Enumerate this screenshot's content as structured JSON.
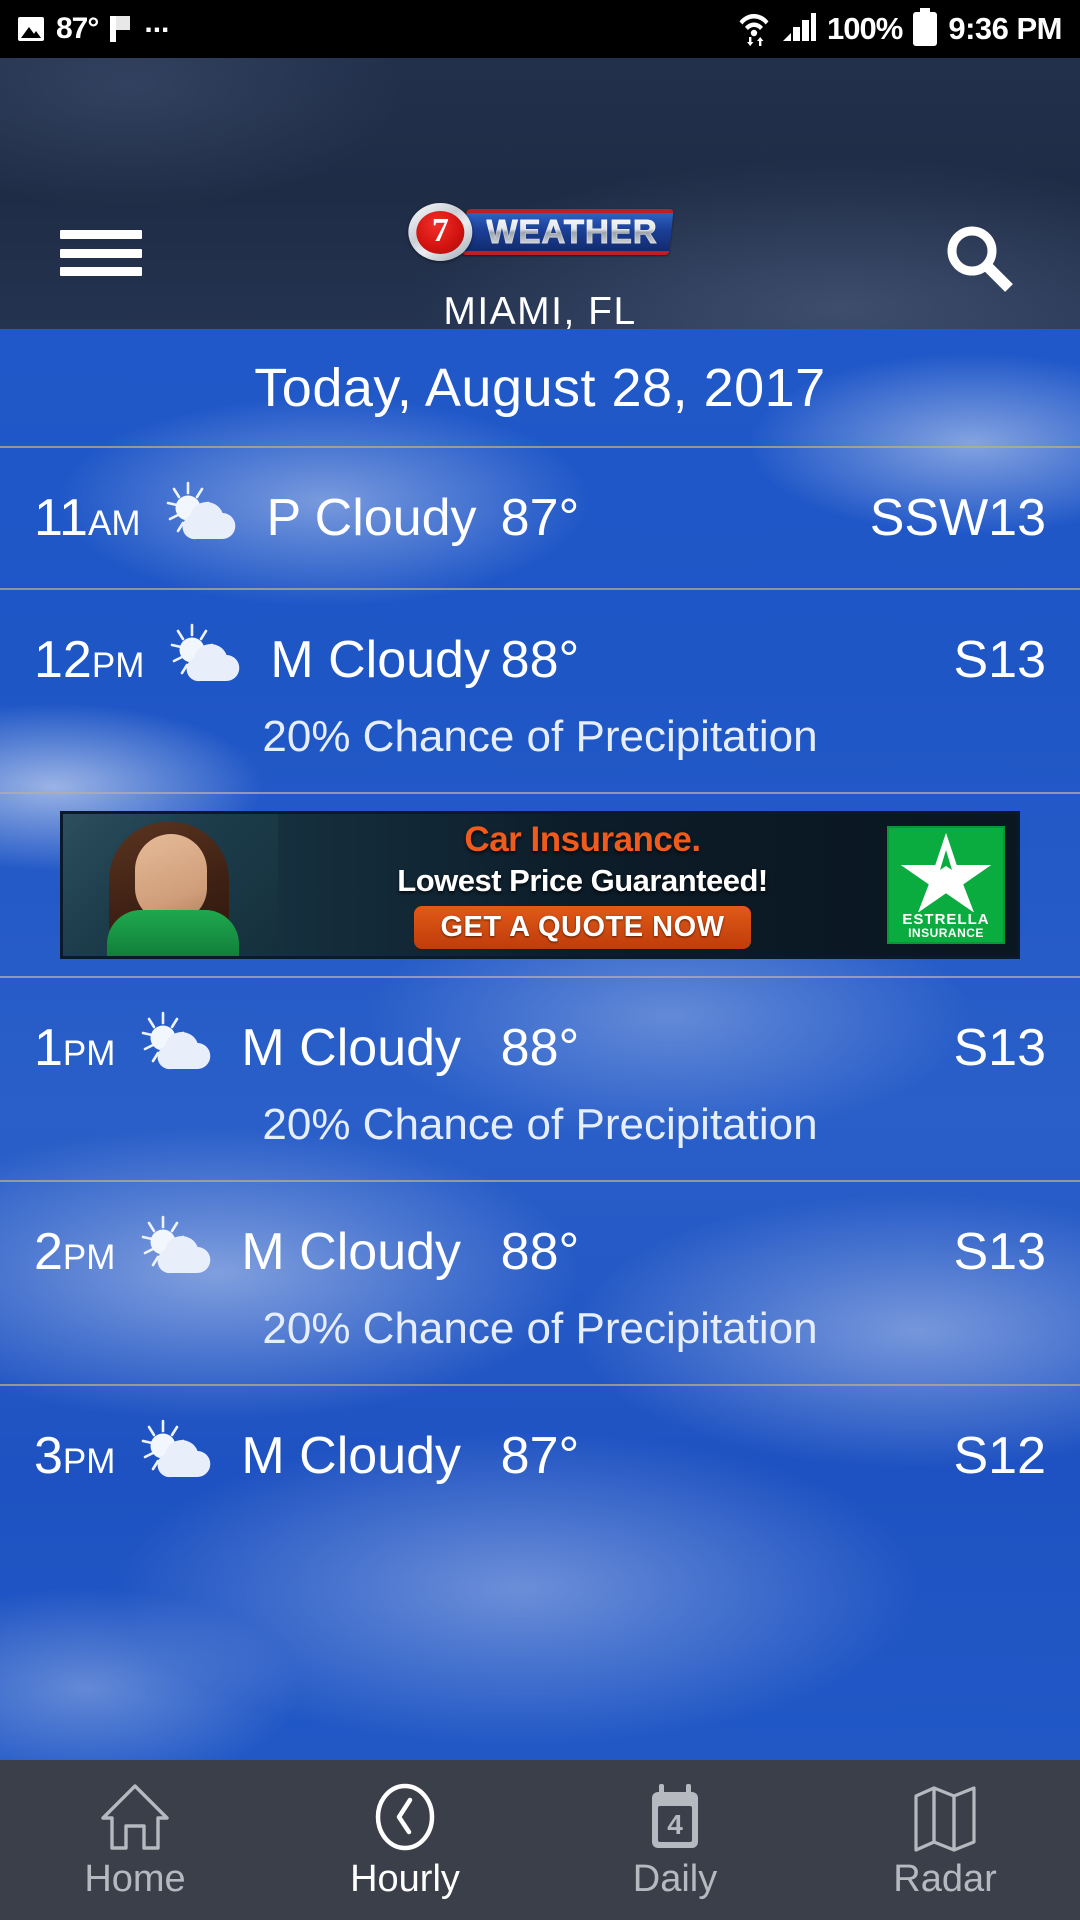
{
  "status_bar": {
    "temperature": "87°",
    "overflow_dots": "...",
    "battery_percent": "100%",
    "time": "9:36 PM",
    "icons": [
      "photo-icon",
      "flag-icon",
      "wifi-icon",
      "signal-icon",
      "battery-icon"
    ]
  },
  "header": {
    "menu_icon": "hamburger-menu-icon",
    "search_icon": "search-icon",
    "logo_number": "7",
    "logo_word": "WEATHER",
    "location": "MIAMI, FL"
  },
  "main": {
    "date_heading": "Today, August 28, 2017",
    "hours": [
      {
        "time": "11",
        "meridiem": "AM",
        "icon": "partly-cloudy-icon",
        "condition": "P Cloudy",
        "temperature": "87°",
        "wind": "SSW13",
        "precipitation": null
      },
      {
        "time": "12",
        "meridiem": "PM",
        "icon": "partly-cloudy-icon",
        "condition": "M Cloudy",
        "temperature": "88°",
        "wind": "S13",
        "precipitation": "20% Chance of Precipitation"
      },
      {
        "time": "1",
        "meridiem": "PM",
        "icon": "partly-cloudy-icon",
        "condition": "M Cloudy",
        "temperature": "88°",
        "wind": "S13",
        "precipitation": "20% Chance of Precipitation"
      },
      {
        "time": "2",
        "meridiem": "PM",
        "icon": "partly-cloudy-icon",
        "condition": "M Cloudy",
        "temperature": "88°",
        "wind": "S13",
        "precipitation": "20% Chance of Precipitation"
      },
      {
        "time": "3",
        "meridiem": "PM",
        "icon": "partly-cloudy-icon",
        "condition": "M Cloudy",
        "temperature": "87°",
        "wind": "S12",
        "precipitation": null
      }
    ]
  },
  "advertisement": {
    "headline": "Car Insurance.",
    "subhead": "Lowest Price Guaranteed!",
    "cta_label": "GET A QUOTE NOW",
    "brand_line1": "ESTRELLA",
    "brand_line2": "INSURANCE",
    "brand_icon": "star-icon"
  },
  "bottom_nav": {
    "items": [
      {
        "label": "Home",
        "icon": "home-icon",
        "active": false
      },
      {
        "label": "Hourly",
        "icon": "clock-icon",
        "active": true
      },
      {
        "label": "Daily",
        "icon": "calendar-icon",
        "active": false,
        "badge": "4"
      },
      {
        "label": "Radar",
        "icon": "map-icon",
        "active": false
      }
    ]
  },
  "colors": {
    "sky_blue": "#2058c9",
    "header_navy": "#22304c",
    "nav_bar": "#3b3f49",
    "divider_gold": "#beaf82",
    "ad_orange": "#ef5a1d",
    "brand_green": "#0bac3f",
    "logo_red": "#d41410"
  }
}
